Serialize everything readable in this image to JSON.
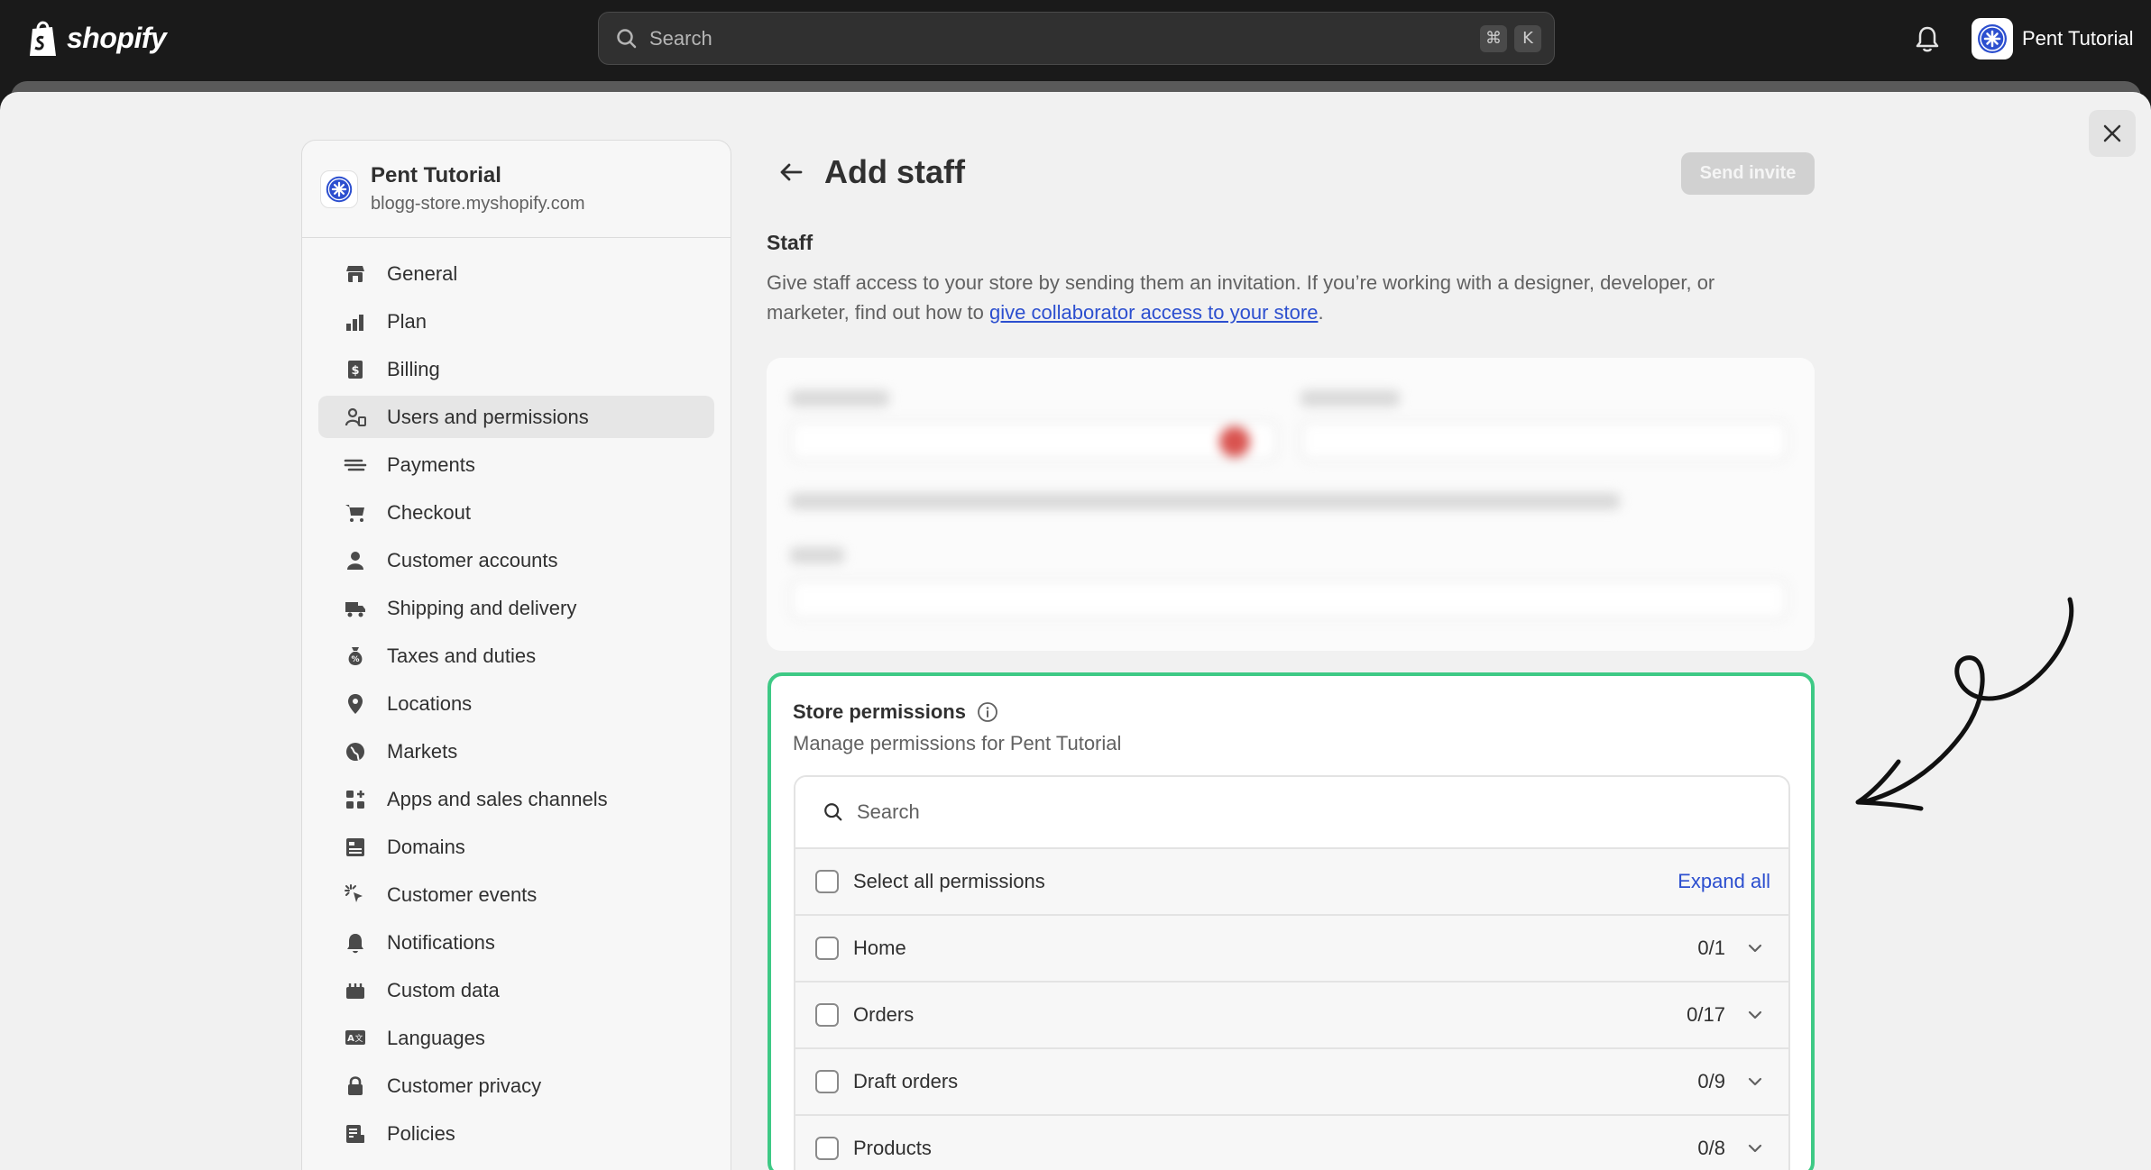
{
  "topbar": {
    "brand": "shopify",
    "search_placeholder": "Search",
    "shortcut_keys": [
      "⌘",
      "K"
    ],
    "account_name": "Pent Tutorial"
  },
  "sidebar": {
    "store_name": "Pent Tutorial",
    "store_url": "blogg-store.myshopify.com",
    "items": [
      {
        "label": "General",
        "icon": "store-icon"
      },
      {
        "label": "Plan",
        "icon": "plan-icon"
      },
      {
        "label": "Billing",
        "icon": "billing-icon"
      },
      {
        "label": "Users and permissions",
        "icon": "users-icon",
        "active": true
      },
      {
        "label": "Payments",
        "icon": "payments-icon"
      },
      {
        "label": "Checkout",
        "icon": "cart-icon"
      },
      {
        "label": "Customer accounts",
        "icon": "person-icon"
      },
      {
        "label": "Shipping and delivery",
        "icon": "truck-icon"
      },
      {
        "label": "Taxes and duties",
        "icon": "tax-icon"
      },
      {
        "label": "Locations",
        "icon": "location-icon"
      },
      {
        "label": "Markets",
        "icon": "globe-icon"
      },
      {
        "label": "Apps and sales channels",
        "icon": "apps-icon"
      },
      {
        "label": "Domains",
        "icon": "domains-icon"
      },
      {
        "label": "Customer events",
        "icon": "cursor-icon"
      },
      {
        "label": "Notifications",
        "icon": "bell-icon"
      },
      {
        "label": "Custom data",
        "icon": "data-icon"
      },
      {
        "label": "Languages",
        "icon": "language-icon"
      },
      {
        "label": "Customer privacy",
        "icon": "lock-icon"
      },
      {
        "label": "Policies",
        "icon": "policy-icon"
      }
    ]
  },
  "main": {
    "title": "Add staff",
    "send_invite_label": "Send invite",
    "staff_section": {
      "title": "Staff",
      "desc_before_link": "Give staff access to your store by sending them an invitation. If you’re working with a designer, developer, or marketer, find out how to ",
      "link_text": "give collaborator access to your store",
      "desc_after_link": "."
    },
    "permissions": {
      "title": "Store permissions",
      "subtitle": "Manage permissions for Pent Tutorial",
      "search_placeholder": "Search",
      "select_all_label": "Select all permissions",
      "expand_all_label": "Expand all",
      "rows": [
        {
          "label": "Home",
          "count": "0/1"
        },
        {
          "label": "Orders",
          "count": "0/17"
        },
        {
          "label": "Draft orders",
          "count": "0/9"
        },
        {
          "label": "Products",
          "count": "0/8"
        }
      ]
    }
  },
  "colors": {
    "accent_green": "#3ec985",
    "link_blue": "#2c4fcf",
    "topbar_bg": "#1a1a1a"
  }
}
